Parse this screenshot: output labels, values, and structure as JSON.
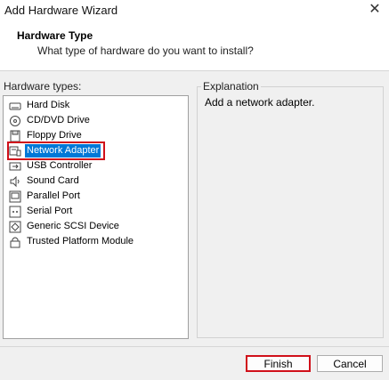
{
  "window": {
    "title": "Add Hardware Wizard",
    "close_glyph": "✕"
  },
  "header": {
    "title": "Hardware Type",
    "subtitle": "What type of hardware do you want to install?"
  },
  "list_label": "Hardware types:",
  "hardware_types": [
    {
      "label": "Hard Disk",
      "icon": "hard-disk-icon"
    },
    {
      "label": "CD/DVD Drive",
      "icon": "cd-dvd-icon"
    },
    {
      "label": "Floppy Drive",
      "icon": "floppy-icon"
    },
    {
      "label": "Network Adapter",
      "icon": "network-adapter-icon",
      "selected": true
    },
    {
      "label": "USB Controller",
      "icon": "usb-icon"
    },
    {
      "label": "Sound Card",
      "icon": "sound-icon"
    },
    {
      "label": "Parallel Port",
      "icon": "parallel-port-icon"
    },
    {
      "label": "Serial Port",
      "icon": "serial-port-icon"
    },
    {
      "label": "Generic SCSI Device",
      "icon": "scsi-icon"
    },
    {
      "label": "Trusted Platform Module",
      "icon": "tpm-icon"
    }
  ],
  "explanation": {
    "legend": "Explanation",
    "text": "Add a network adapter."
  },
  "buttons": {
    "finish": "Finish",
    "cancel": "Cancel"
  },
  "colors": {
    "selection": "#0078d7",
    "highlight_border": "#d0101a"
  }
}
